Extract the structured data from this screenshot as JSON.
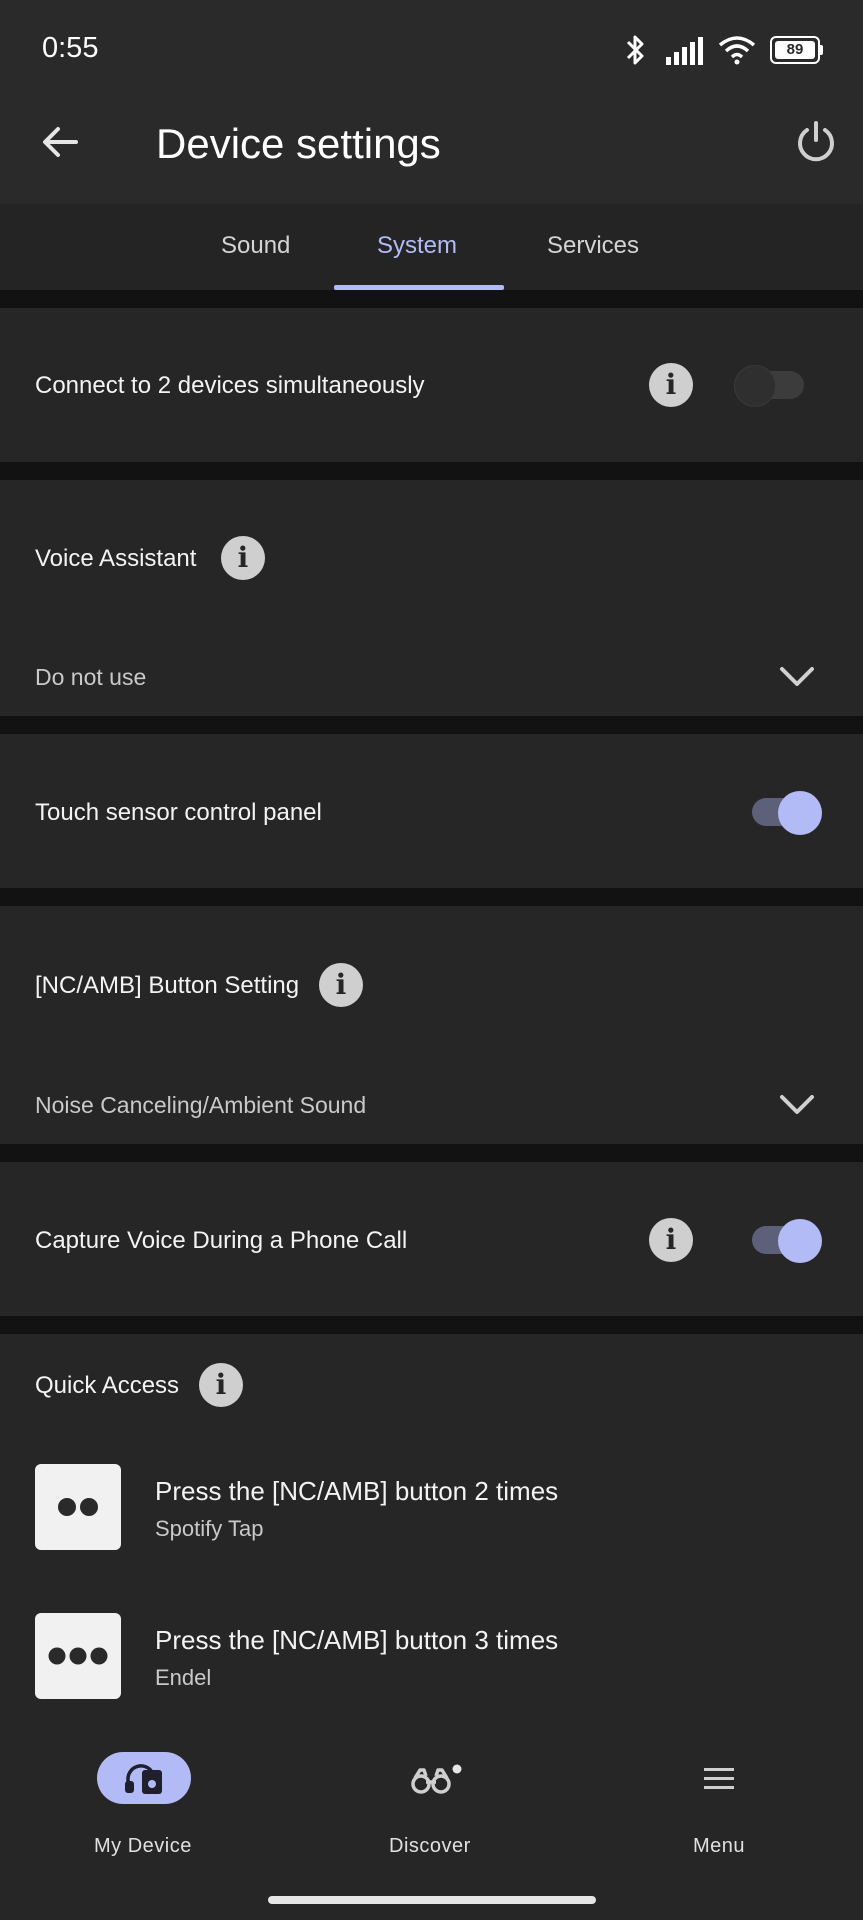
{
  "status": {
    "time": "0:55",
    "battery": "89"
  },
  "header": {
    "title": "Device settings"
  },
  "tabs": [
    {
      "label": "Sound"
    },
    {
      "label": "System"
    },
    {
      "label": "Services"
    }
  ],
  "settings": {
    "connect": {
      "label": "Connect to 2 devices simultaneously",
      "enabled": false
    },
    "voice_assistant": {
      "label": "Voice Assistant",
      "value": "Do not use"
    },
    "touch_sensor": {
      "label": "Touch sensor control panel",
      "enabled": true
    },
    "nc_amb": {
      "label": "[NC/AMB] Button Setting",
      "value": "Noise Canceling/Ambient Sound"
    },
    "capture_voice": {
      "label": "Capture Voice During a Phone Call",
      "enabled": true
    },
    "quick_access": {
      "label": "Quick Access",
      "items": [
        {
          "title": "Press the [NC/AMB] button 2 times",
          "subtitle": "Spotify Tap"
        },
        {
          "title": "Press the [NC/AMB] button 3 times",
          "subtitle": "Endel"
        }
      ]
    }
  },
  "nav": {
    "my_device": "My Device",
    "discover": "Discover",
    "menu": "Menu"
  },
  "colors": {
    "accent": "#b3bbf6",
    "background": "#121212",
    "surface": "#262626"
  },
  "icons": [
    "back-arrow-icon",
    "power-icon",
    "info-icon",
    "chevron-down-icon",
    "headphones-icon",
    "binoculars-icon",
    "hamburger-icon",
    "bluetooth-icon",
    "signal-icon",
    "wifi-icon",
    "battery-icon"
  ]
}
